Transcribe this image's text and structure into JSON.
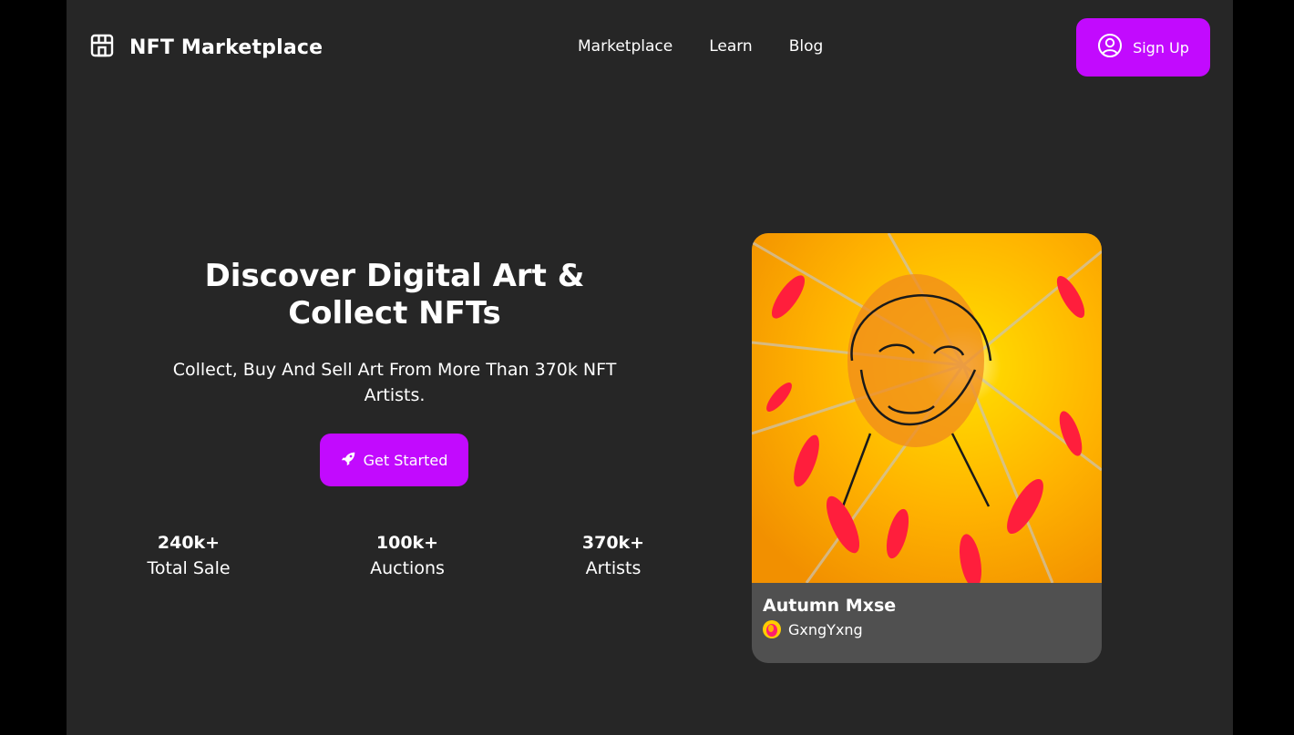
{
  "header": {
    "logo_icon": "storefront-icon",
    "brand": "NFT Marketplace",
    "nav": [
      {
        "label": "Marketplace"
      },
      {
        "label": "Learn"
      },
      {
        "label": "Blog"
      }
    ],
    "signup": {
      "label": "Sign Up",
      "icon": "user-circle-icon"
    }
  },
  "hero": {
    "title": "Discover Digital Art & Collect NFTs",
    "subtitle": "Collect, Buy And Sell Art From More Than 370k NFT Artists.",
    "cta": {
      "label": "Get Started",
      "icon": "rocket-icon"
    },
    "stats": [
      {
        "value": "240k+",
        "label": "Total Sale"
      },
      {
        "value": "100k+",
        "label": "Auctions"
      },
      {
        "value": "370k+",
        "label": "Artists"
      }
    ]
  },
  "featured": {
    "title": "Autumn Mxse",
    "artist": "GxngYxng"
  },
  "colors": {
    "accent": "#c20afe",
    "background": "#262626",
    "card": "#505050"
  }
}
